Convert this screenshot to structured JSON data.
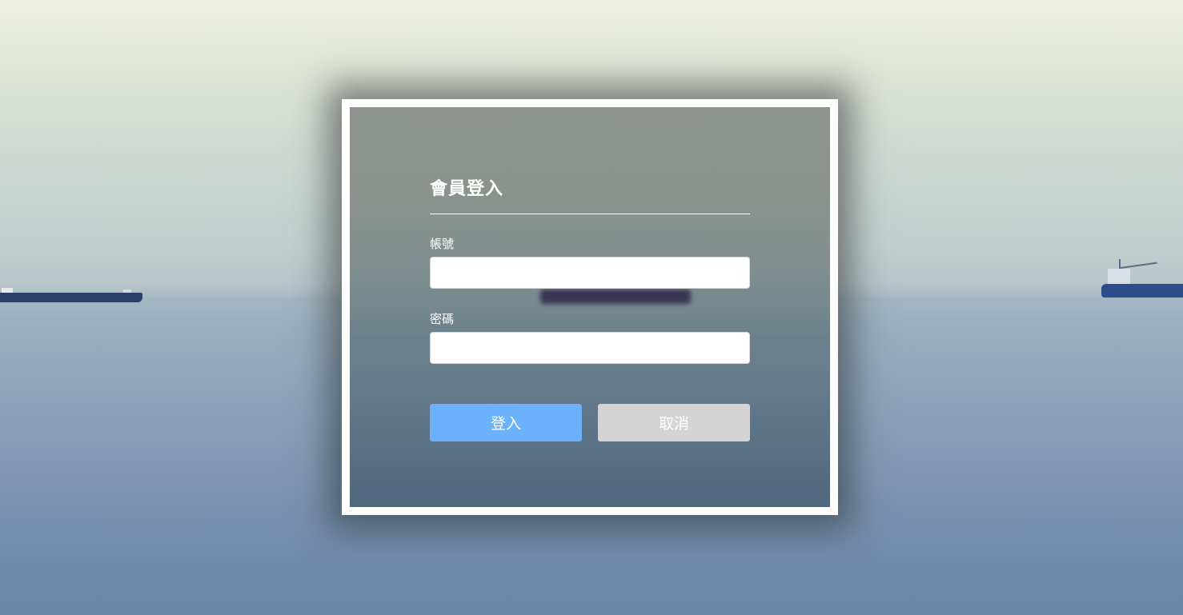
{
  "login": {
    "title": "會員登入",
    "account_label": "帳號",
    "account_value": "",
    "password_label": "密碼",
    "password_value": "",
    "login_button": "登入",
    "cancel_button": "取消"
  },
  "colors": {
    "login_button": "#6cb2fb",
    "cancel_button": "#d4d4d4",
    "card_border": "#ffffff"
  }
}
